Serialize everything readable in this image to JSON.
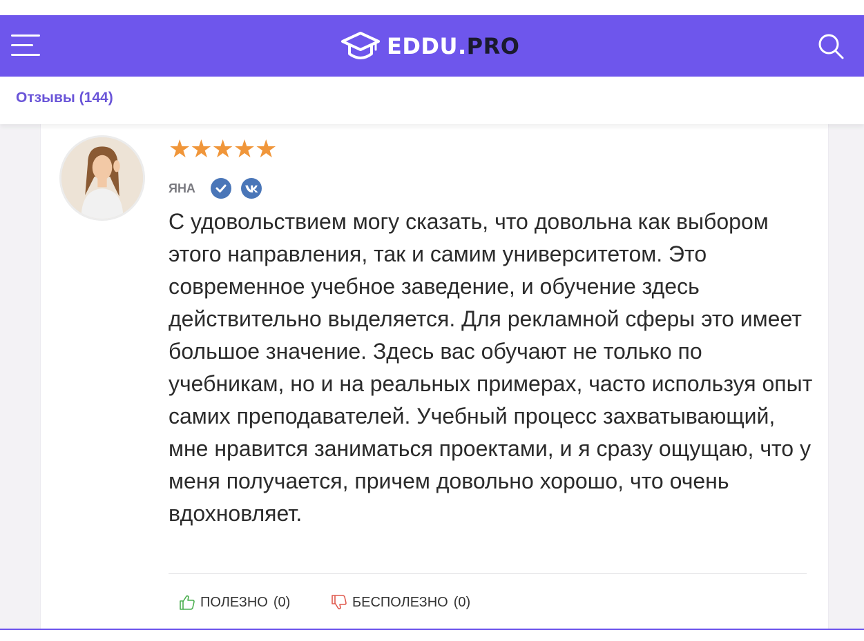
{
  "header": {
    "logo_text_main": "EDDU.",
    "logo_text_suffix": "PRO",
    "brand_color": "#6e56ec",
    "menu_icon": "hamburger-menu-icon",
    "search_icon": "search-icon",
    "logo_icon": "graduation-cap-icon"
  },
  "subnav": {
    "reviews_label": "Отзывы (144)"
  },
  "review": {
    "rating": 5,
    "rating_max": 5,
    "stars": "★★★★★",
    "star_color": "#f0963a",
    "author": "ЯНА",
    "badges": [
      "verified-check-icon",
      "vk-icon"
    ],
    "text": "С удовольствием могу сказать, что довольна как выбором этого направления, так и самим университетом. Это современное учебное заведение, и обучение здесь действительно выделяется. Для рекламной сферы это имеет большое значение. Здесь вас обучают не только по учебникам, но и на реальных примерах, часто используя опыт самих преподавателей. Учебный процесс захватывающий, мне нравится заниматься проектами, и я сразу ощущаю, что у меня получается, причем довольно хорошо, что очень вдохновляет.",
    "useful_label": "ПОЛЕЗНО",
    "useful_count": "(0)",
    "useless_label": "БЕСПОЛЕЗНО",
    "useless_count": "(0)"
  }
}
